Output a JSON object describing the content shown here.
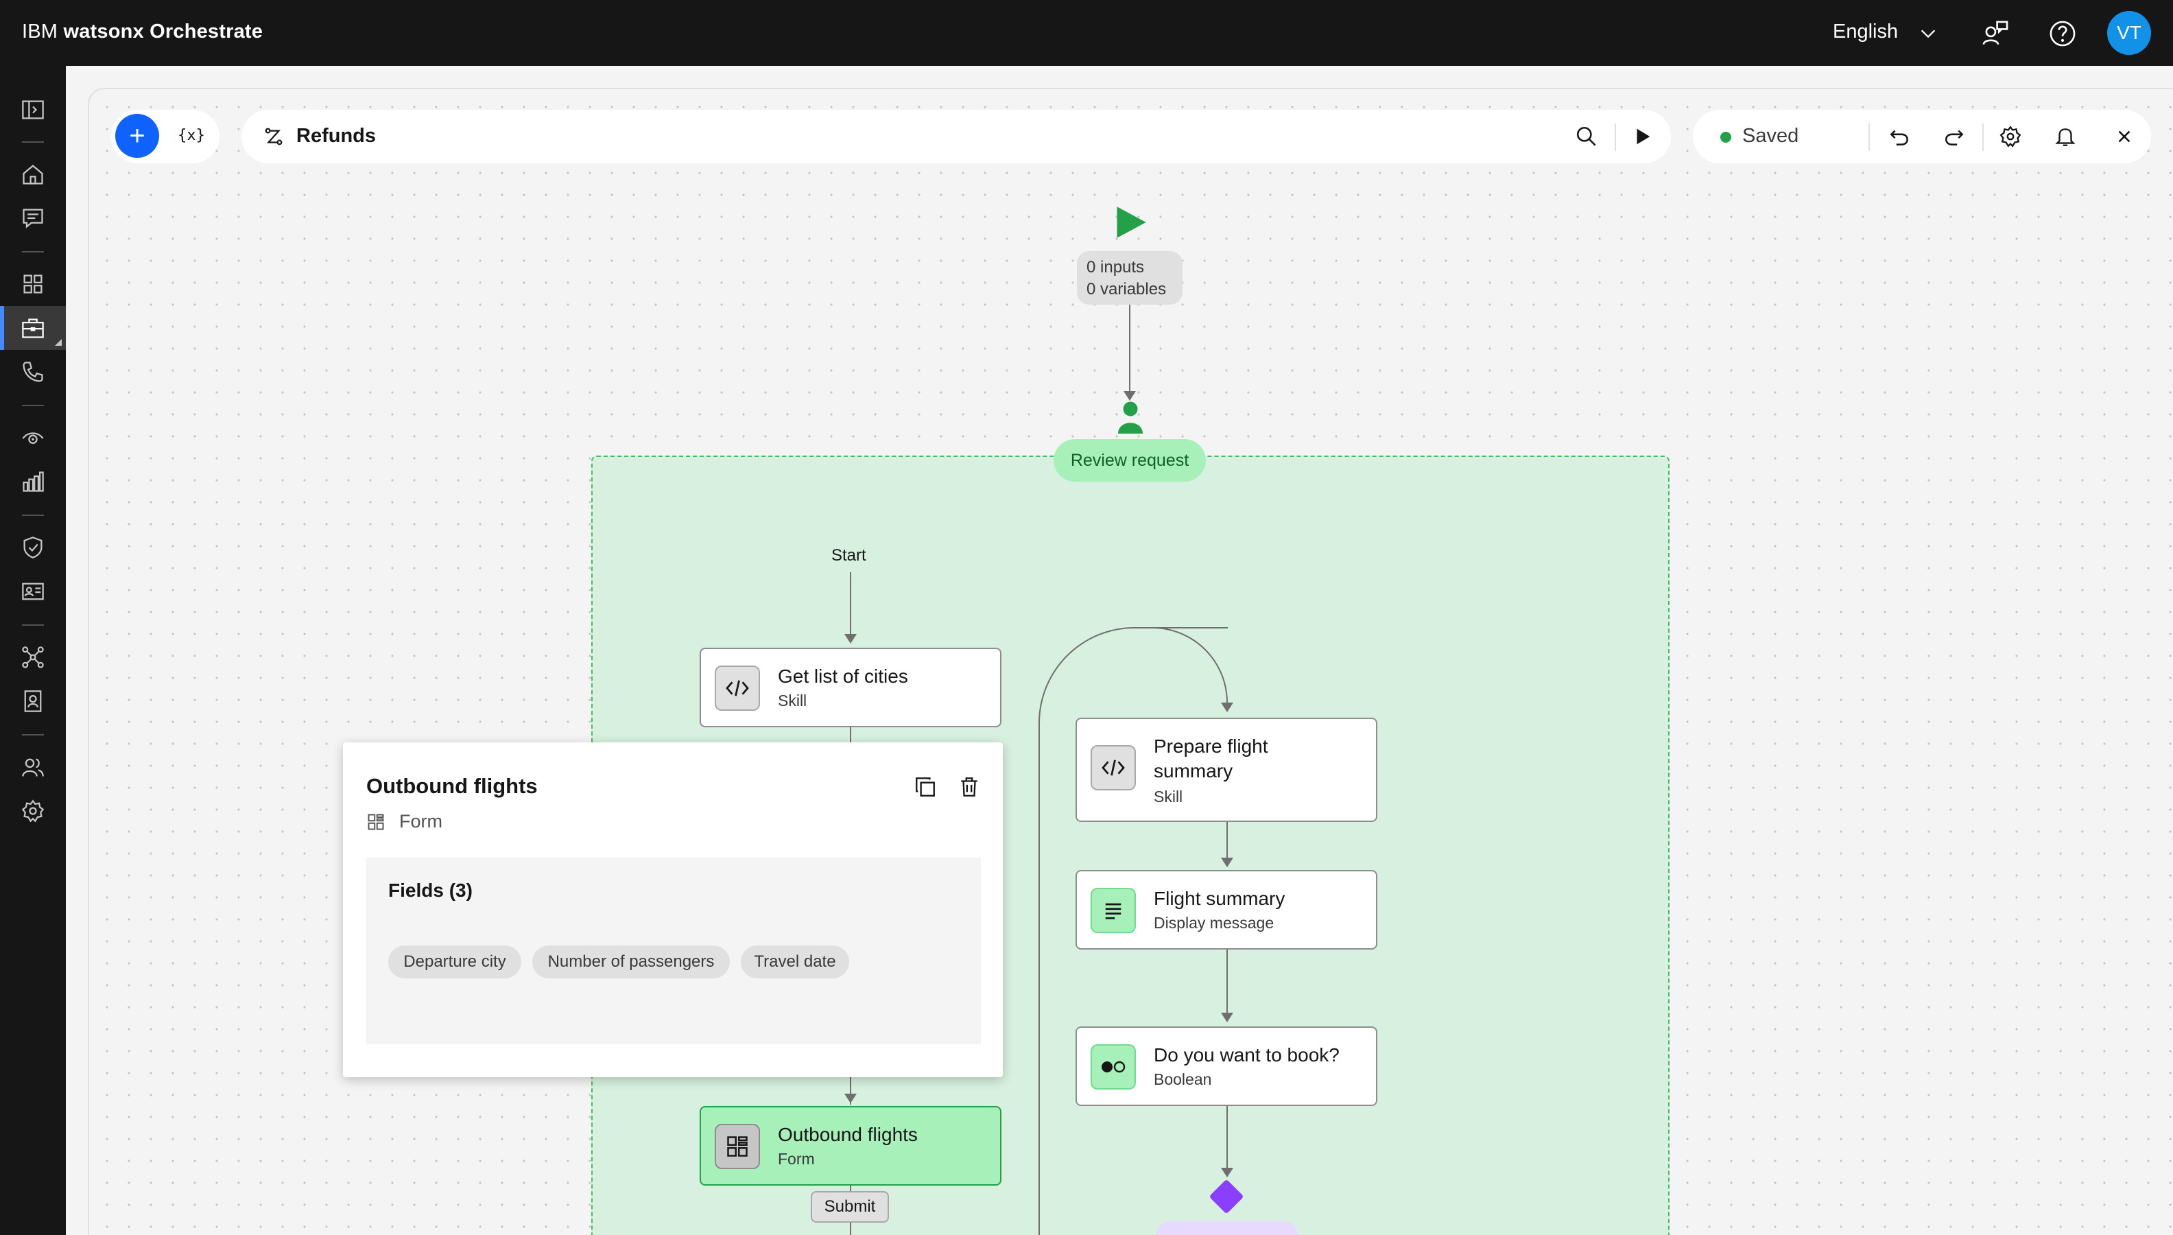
{
  "header": {
    "brand_prefix": "IBM",
    "brand_name": "watsonx Orchestrate",
    "language": "English",
    "avatar_initials": "VT"
  },
  "sidebar": {
    "items": [
      {
        "icon": "side-panel-icon"
      },
      {
        "icon": "home-icon"
      },
      {
        "icon": "chat-icon"
      },
      {
        "icon": "apps-grid-icon"
      },
      {
        "icon": "toolbox-icon",
        "active": true
      },
      {
        "icon": "phone-icon"
      },
      {
        "icon": "view-icon"
      },
      {
        "icon": "analytics-icon"
      },
      {
        "icon": "security-shield-icon"
      },
      {
        "icon": "identification-icon"
      },
      {
        "icon": "connections-icon"
      },
      {
        "icon": "user-profile-icon"
      },
      {
        "icon": "users-icon"
      },
      {
        "icon": "settings-icon"
      }
    ]
  },
  "toolbar": {
    "add_label": "+",
    "variables_label": "{x}",
    "flow_title": "Refunds",
    "status": "Saved"
  },
  "flow": {
    "io_inputs": "0 inputs",
    "io_variables": "0 variables",
    "group_label": "Review request",
    "start_label": "Start",
    "nodes": [
      {
        "title": "Get list of cities",
        "type": "Skill"
      },
      {
        "title_line1": "Prepare flight",
        "title_line2": "summary",
        "type": "Skill"
      },
      {
        "title": "Flight summary",
        "type": "Display message"
      },
      {
        "title": "Do you want to book?",
        "type": "Boolean"
      },
      {
        "title": "Outbound flights",
        "type": "Form"
      }
    ],
    "submit_label": "Submit"
  },
  "popover": {
    "title": "Outbound flights",
    "type": "Form",
    "fields_title": "Fields (3)",
    "fields": [
      "Departure city",
      "Number of passengers",
      "Travel date"
    ]
  },
  "colors": {
    "accent": "#0f62fe",
    "success": "#24a148",
    "group_bg": "#d7f0df",
    "decision": "#8a3ffc"
  }
}
